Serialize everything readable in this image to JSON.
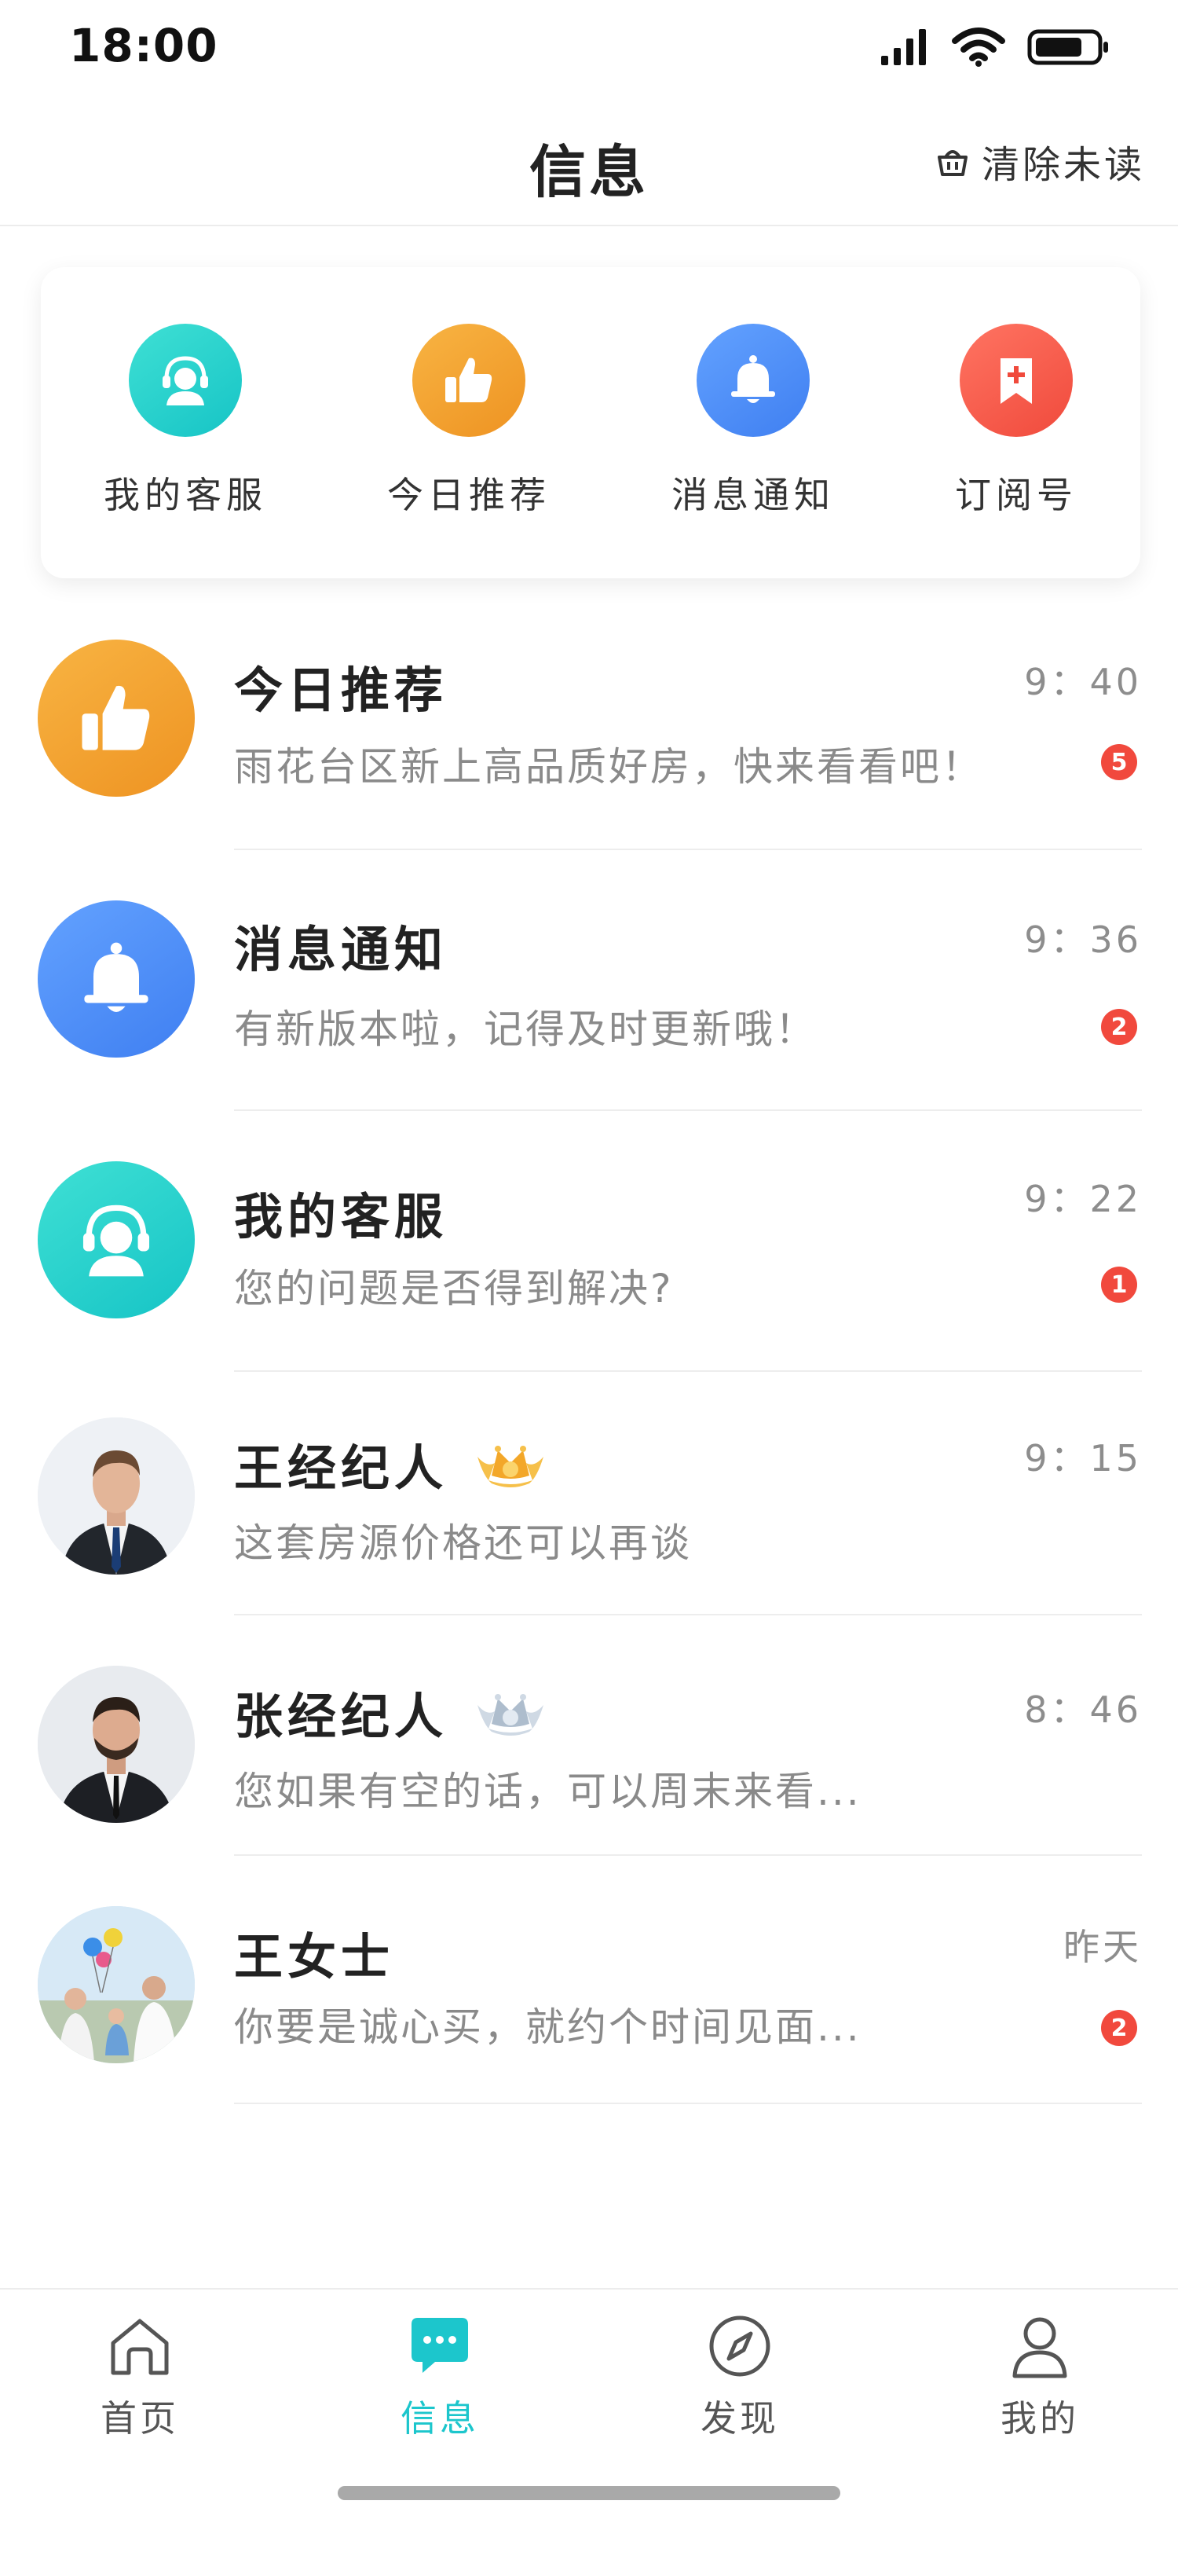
{
  "status_bar": {
    "time": "18:00",
    "icons": [
      "signal-icon",
      "wifi-icon",
      "battery-icon"
    ]
  },
  "nav": {
    "title": "信息",
    "clear_unread": "清除未读",
    "clear_icon": "basket-icon"
  },
  "quick_entries": [
    {
      "label": "我的客服",
      "icon": "headset-user-icon",
      "color": "#1fd0c8"
    },
    {
      "label": "今日推荐",
      "icon": "thumbs-up-icon",
      "color": "#f2a023"
    },
    {
      "label": "消息通知",
      "icon": "bell-icon",
      "color": "#4f8cf7"
    },
    {
      "label": "订阅号",
      "icon": "bookmark-plus-icon",
      "color": "#f4594a"
    }
  ],
  "messages": [
    {
      "name": "今日推荐",
      "preview": "雨花台区新上高品质好房，快来看看吧！",
      "time": "9：40",
      "badge": "5",
      "avatar": "thumbs-up-icon"
    },
    {
      "name": "消息通知",
      "preview": "有新版本啦，记得及时更新哦！",
      "time": "9：36",
      "badge": "2",
      "avatar": "bell-icon"
    },
    {
      "name": "我的客服",
      "preview": "您的问题是否得到解决?",
      "time": "9：22",
      "badge": "1",
      "avatar": "headset-user-icon"
    },
    {
      "name": "王经纪人",
      "preview": "这套房源价格还可以再谈",
      "time": "9：15",
      "badge": "",
      "avatar": "agent-photo",
      "rank": "gold-crown-icon"
    },
    {
      "name": "张经纪人",
      "preview": "您如果有空的话，可以周末来看...",
      "time": "8：46",
      "badge": "",
      "avatar": "agent-photo",
      "rank": "silver-crown-icon"
    },
    {
      "name": "王女士",
      "preview": "你要是诚心买，就约个时间见面...",
      "time": "昨天",
      "badge": "2",
      "avatar": "family-photo"
    }
  ],
  "tabs": [
    {
      "label": "首页",
      "icon": "home-icon",
      "active": false
    },
    {
      "label": "信息",
      "icon": "chat-icon",
      "active": true
    },
    {
      "label": "发现",
      "icon": "compass-icon",
      "active": false
    },
    {
      "label": "我的",
      "icon": "user-icon",
      "active": false
    }
  ],
  "colors": {
    "accent": "#1cc6cc",
    "badge": "#f1493d",
    "muted_text": "#8a8a8a"
  }
}
